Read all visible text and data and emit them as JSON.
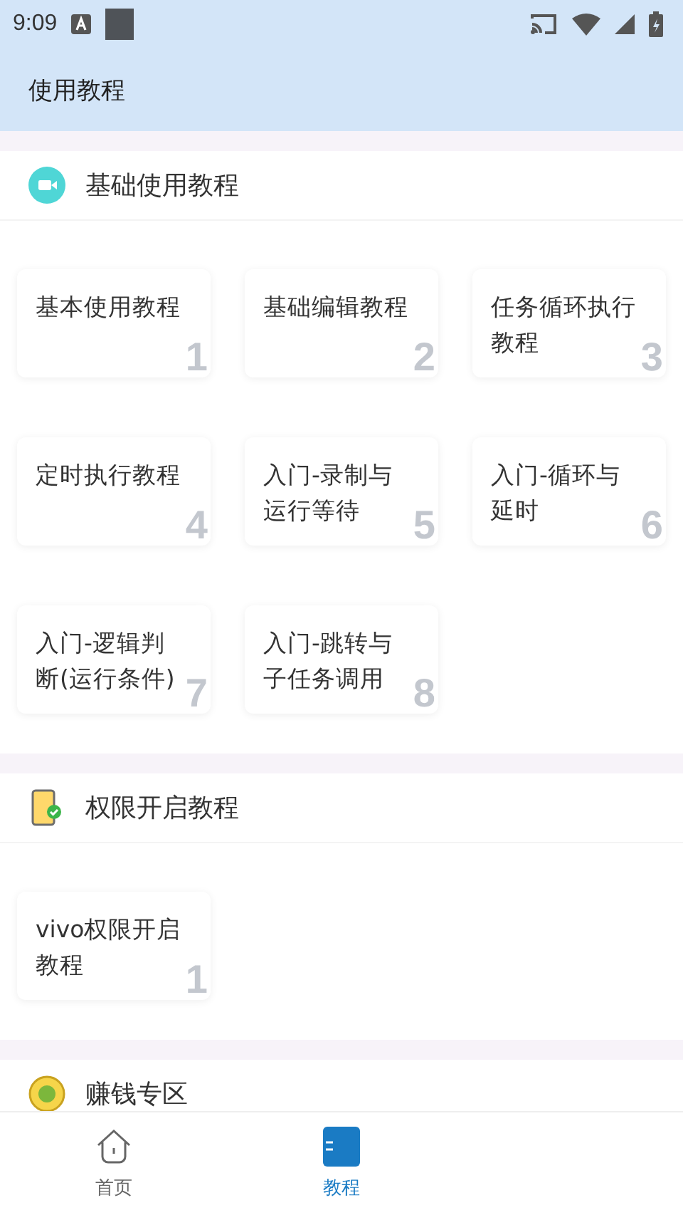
{
  "status_bar": {
    "time": "9:09"
  },
  "app_bar": {
    "title": "使用教程"
  },
  "sections": [
    {
      "title": "基础使用教程",
      "cards": [
        {
          "title": "基本使用教程",
          "number": "1"
        },
        {
          "title": "基础编辑教程",
          "number": "2"
        },
        {
          "title": "任务循环执行教程",
          "number": "3"
        },
        {
          "title": "定时执行教程",
          "number": "4"
        },
        {
          "title": "入门-录制与运行等待",
          "number": "5"
        },
        {
          "title": "入门-循环与延时",
          "number": "6"
        },
        {
          "title": "入门-逻辑判断(运行条件)",
          "number": "7"
        },
        {
          "title": "入门-跳转与子任务调用",
          "number": "8"
        }
      ]
    },
    {
      "title": "权限开启教程",
      "cards": [
        {
          "title": "vivo权限开启教程",
          "number": "1"
        }
      ]
    },
    {
      "title": "赚钱专区"
    }
  ],
  "bottom_nav": [
    {
      "label": "首页",
      "selected": false
    },
    {
      "label": "教程",
      "selected": true
    }
  ]
}
